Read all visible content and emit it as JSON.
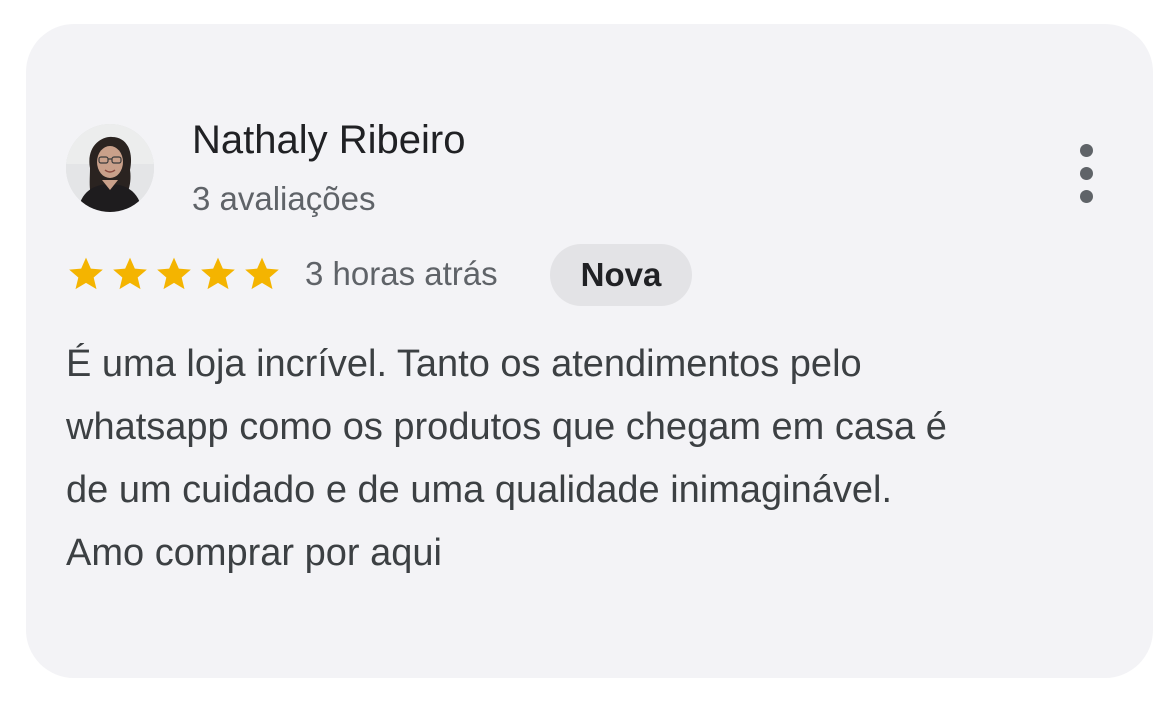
{
  "review": {
    "author_name": "Nathaly Ribeiro",
    "review_count": "3 avaliações",
    "rating": 5,
    "rating_max": 5,
    "time": "3 horas atrás",
    "badge": "Nova",
    "text": "É uma loja incrível. Tanto os atendimentos pelo\nwhatsapp como os produtos que chegam em casa é\nde um cuidado e de uma qualidade inimaginável.\nAmo comprar por aqui"
  },
  "icons": {
    "menu": "more-vert-icon",
    "star": "star-icon",
    "avatar": "profile-photo"
  },
  "colors": {
    "card_background": "#f3f3f6",
    "star": "#f4b400",
    "badge_background": "#e3e3e6",
    "primary_text": "#202124",
    "secondary_text": "#5f6368"
  }
}
